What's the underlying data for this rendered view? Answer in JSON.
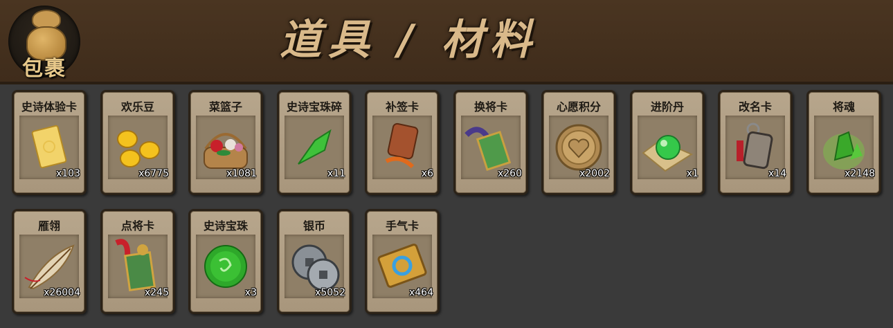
{
  "header": {
    "bag_label": "包裹",
    "title": "道具 / 材料"
  },
  "items": [
    {
      "name": "史诗体验卡",
      "count": "x103",
      "icon": "gold-card-icon"
    },
    {
      "name": "欢乐豆",
      "count": "x6775",
      "icon": "gold-beans-icon"
    },
    {
      "name": "菜篮子",
      "count": "x1081",
      "icon": "flower-basket-icon"
    },
    {
      "name": "史诗宝珠碎",
      "count": "x11",
      "icon": "green-shard-icon"
    },
    {
      "name": "补签卡",
      "count": "x6",
      "icon": "sign-tag-icon"
    },
    {
      "name": "换将卡",
      "count": "x260",
      "icon": "jade-token-icon"
    },
    {
      "name": "心愿积分",
      "count": "x2002",
      "icon": "heart-coin-icon"
    },
    {
      "name": "进阶丹",
      "count": "x1",
      "icon": "green-pill-icon"
    },
    {
      "name": "改名卡",
      "count": "x14",
      "icon": "name-token-icon"
    },
    {
      "name": "将魂",
      "count": "x2148",
      "icon": "green-crystal-icon"
    },
    {
      "name": "雁翎",
      "count": "x26004",
      "icon": "feather-icon"
    },
    {
      "name": "点将卡",
      "count": "x245",
      "icon": "red-tassel-token-icon"
    },
    {
      "name": "史诗宝珠",
      "count": "x3",
      "icon": "green-orb-icon"
    },
    {
      "name": "银币",
      "count": "x5052",
      "icon": "silver-coins-icon"
    },
    {
      "name": "手气卡",
      "count": "x464",
      "icon": "luck-card-icon"
    }
  ]
}
